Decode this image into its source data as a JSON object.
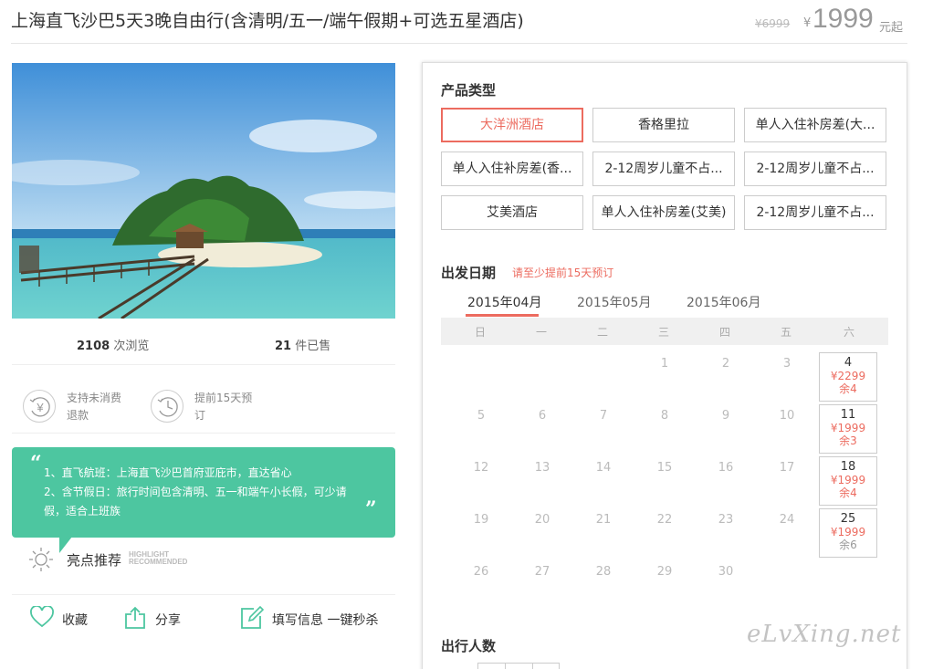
{
  "header": {
    "title": "上海直飞沙巴5天3晚自由行(含清明/五一/端午假期+可选五星酒店)",
    "original_price": "¥6999",
    "currency": "¥",
    "price": "1999",
    "price_suffix": "元起"
  },
  "stats": {
    "views_count": "2108",
    "views_label": "次浏览",
    "sold_count": "21",
    "sold_label": "件已售"
  },
  "features": [
    {
      "icon": "yen-refund-icon",
      "text": "支持未消费退款"
    },
    {
      "icon": "clock-icon",
      "text": "提前15天预订"
    }
  ],
  "highlight": {
    "open_quote": "“",
    "close_quote": "”",
    "line1": "1、直飞航班：上海直飞沙巴首府亚庇市，直达省心",
    "line2": "2、含节假日：旅行时间包含清明、五一和端午小长假，可少请假，适合上班族",
    "label": "亮点推荐",
    "label_en_1": "HIGHLIGHT",
    "label_en_2": "RECOMMENDED"
  },
  "actions": {
    "favorite": "收藏",
    "share": "分享",
    "booking": "填写信息 一键秒杀"
  },
  "product_type": {
    "title": "产品类型",
    "options": [
      "大洋洲酒店",
      "香格里拉",
      "单人入住补房差(大...",
      "单人入住补房差(香...",
      "2-12周岁儿童不占...",
      "2-12周岁儿童不占...",
      "艾美酒店",
      "单人入住补房差(艾美)",
      "2-12周岁儿童不占..."
    ],
    "selected_index": 0
  },
  "departure": {
    "title": "出发日期",
    "hint": "请至少提前15天预订",
    "months": [
      "2015年04月",
      "2015年05月",
      "2015年06月"
    ],
    "active_month": 0,
    "weekdays": [
      "日",
      "一",
      "二",
      "三",
      "四",
      "五",
      "六"
    ],
    "plain_days": [
      "1",
      "2",
      "3",
      "5",
      "6",
      "7",
      "8",
      "9",
      "10",
      "12",
      "13",
      "14",
      "15",
      "16",
      "17",
      "19",
      "20",
      "21",
      "22",
      "23",
      "24",
      "26",
      "27",
      "28",
      "29",
      "30"
    ],
    "available": [
      {
        "day": "4",
        "price": "¥2299",
        "remain": "余4"
      },
      {
        "day": "11",
        "price": "¥1999",
        "remain": "余3"
      },
      {
        "day": "18",
        "price": "¥1999",
        "remain": "余4"
      },
      {
        "day": "25",
        "price": "¥1999",
        "remain": "余6"
      }
    ]
  },
  "travelers": {
    "title": "出行人数"
  },
  "watermark": "eLvXing.net"
}
